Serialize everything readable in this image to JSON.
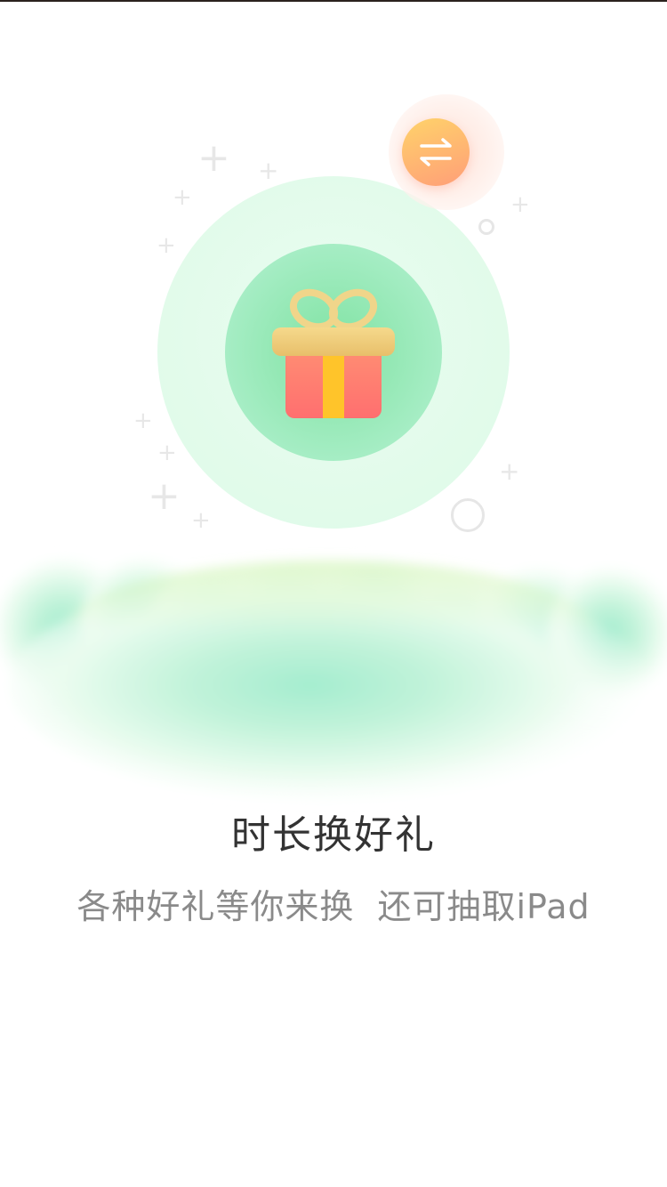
{
  "title": "时长换好礼",
  "subtitle": "各种好礼等你来换  还可抽取iPad",
  "icons": {
    "gift": "gift-icon",
    "exchange": "exchange-arrows-icon"
  },
  "colors": {
    "title_text": "#333333",
    "subtitle_text": "#8a8a8a",
    "circle_green": "#7fe3a2",
    "gift_red": "#ff7a6a",
    "gift_ribbon": "#f0cf7a",
    "badge_orange": "#ff9e78"
  }
}
